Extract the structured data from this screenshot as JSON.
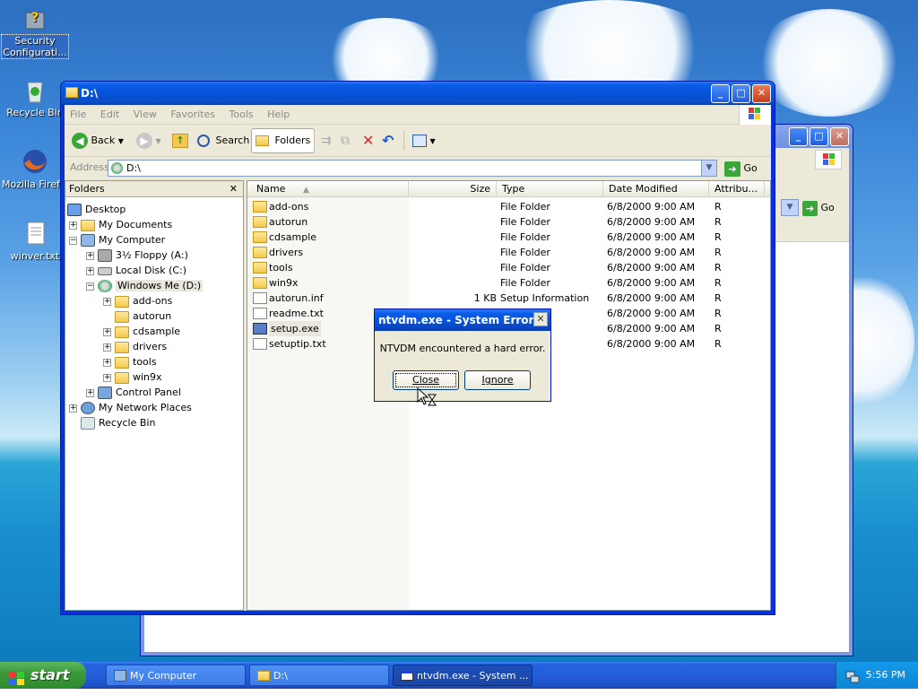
{
  "desktop": {
    "icons": [
      {
        "label": "Security Configurati..."
      },
      {
        "label": "Recycle Bin"
      },
      {
        "label": "Mozilla Firefox"
      },
      {
        "label": "winver.txt"
      }
    ]
  },
  "back_window": {
    "title": "",
    "go_label": "Go"
  },
  "explorer": {
    "title": "D:\\",
    "menu": [
      "File",
      "Edit",
      "View",
      "Favorites",
      "Tools",
      "Help"
    ],
    "toolbar": {
      "back": "Back",
      "search": "Search",
      "folders": "Folders"
    },
    "address_label": "Address",
    "address_value": "D:\\",
    "go_label": "Go",
    "folders_pane": {
      "title": "Folders",
      "tree": [
        {
          "label": "Desktop",
          "expander": ""
        },
        {
          "label": "My Documents",
          "expander": "+"
        },
        {
          "label": "My Computer",
          "expander": "−"
        },
        {
          "label": "3½ Floppy (A:)",
          "expander": "+"
        },
        {
          "label": "Local Disk (C:)",
          "expander": "+"
        },
        {
          "label": "Windows Me (D:)",
          "expander": "−"
        },
        {
          "label": "add-ons",
          "expander": "+"
        },
        {
          "label": "autorun",
          "expander": ""
        },
        {
          "label": "cdsample",
          "expander": "+"
        },
        {
          "label": "drivers",
          "expander": "+"
        },
        {
          "label": "tools",
          "expander": "+"
        },
        {
          "label": "win9x",
          "expander": "+"
        },
        {
          "label": "Control Panel",
          "expander": "+"
        },
        {
          "label": "My Network Places",
          "expander": "+"
        },
        {
          "label": "Recycle Bin",
          "expander": ""
        }
      ]
    },
    "columns": [
      "Name",
      "Size",
      "Type",
      "Date Modified",
      "Attribu..."
    ],
    "files": [
      {
        "name": "add-ons",
        "size": "",
        "type": "File Folder",
        "date": "6/8/2000 9:00 AM",
        "attr": "R"
      },
      {
        "name": "autorun",
        "size": "",
        "type": "File Folder",
        "date": "6/8/2000 9:00 AM",
        "attr": "R"
      },
      {
        "name": "cdsample",
        "size": "",
        "type": "File Folder",
        "date": "6/8/2000 9:00 AM",
        "attr": "R"
      },
      {
        "name": "drivers",
        "size": "",
        "type": "File Folder",
        "date": "6/8/2000 9:00 AM",
        "attr": "R"
      },
      {
        "name": "tools",
        "size": "",
        "type": "File Folder",
        "date": "6/8/2000 9:00 AM",
        "attr": "R"
      },
      {
        "name": "win9x",
        "size": "",
        "type": "File Folder",
        "date": "6/8/2000 9:00 AM",
        "attr": "R"
      },
      {
        "name": "autorun.inf",
        "size": "1 KB",
        "type": "Setup Information",
        "date": "6/8/2000 9:00 AM",
        "attr": "R"
      },
      {
        "name": "readme.txt",
        "size": "",
        "type": "ent",
        "date": "6/8/2000 9:00 AM",
        "attr": "R"
      },
      {
        "name": "setup.exe",
        "size": "",
        "type": "",
        "date": "6/8/2000 9:00 AM",
        "attr": "R"
      },
      {
        "name": "setuptip.txt",
        "size": "",
        "type": "ent",
        "date": "6/8/2000 9:00 AM",
        "attr": "R"
      }
    ]
  },
  "dialog": {
    "title": "ntvdm.exe - System Error",
    "message": "NTVDM encountered a hard error.",
    "close_label": "Close",
    "ignore_label": "Ignore"
  },
  "taskbar": {
    "start_label": "start",
    "tasks": [
      "My Computer",
      "D:\\",
      "ntvdm.exe - System ..."
    ],
    "clock": "5:56 PM"
  }
}
